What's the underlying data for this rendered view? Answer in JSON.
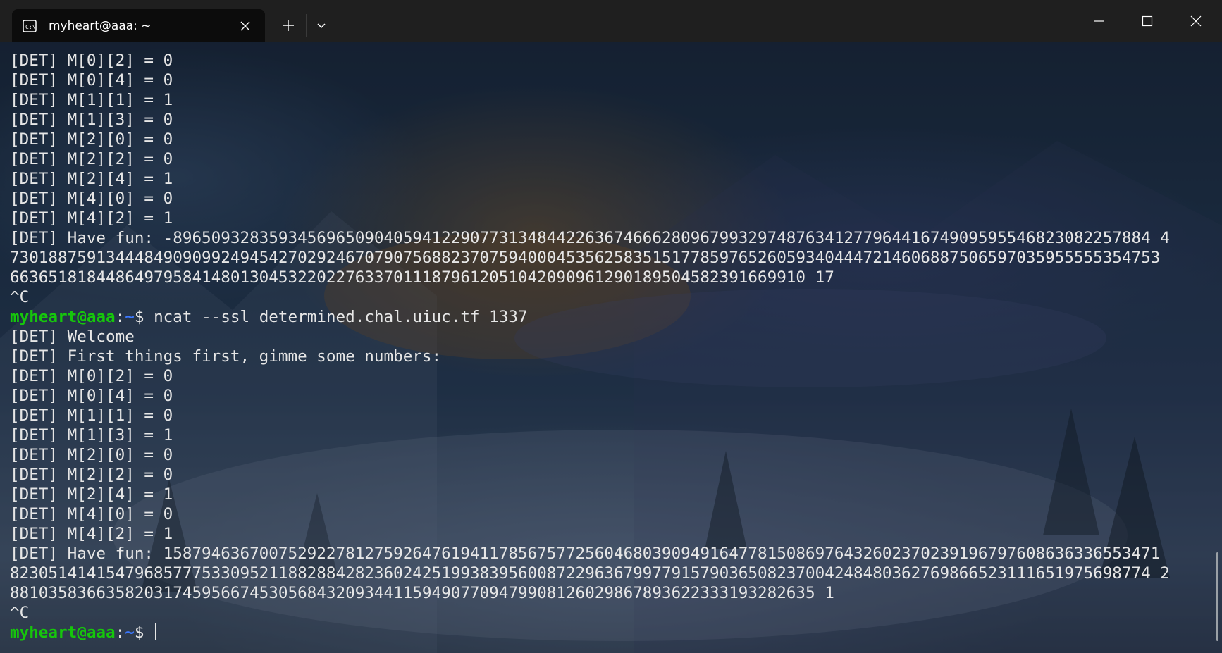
{
  "tab": {
    "title": "myheart@aaa: ~",
    "icon": "terminal-icon"
  },
  "controls": {
    "new_tab_icon": "plus-icon",
    "dropdown_icon": "chevron-down-icon",
    "minimize_icon": "minimize-icon",
    "maximize_icon": "maximize-icon",
    "close_icon": "close-icon"
  },
  "colors": {
    "prompt_user": "#16c60c",
    "prompt_path": "#3b78ff",
    "text": "#e6e6e6",
    "titlebar": "#1f1f1f",
    "tab_active": "#0c0c0c"
  },
  "prompt": {
    "user": "myheart@aaa",
    "sep": ":",
    "path": "~",
    "sign": "$ "
  },
  "terminal": {
    "lines": [
      "[DET] M[0][2] = 0",
      "[DET] M[0][4] = 0",
      "[DET] M[1][1] = 1",
      "[DET] M[1][3] = 0",
      "[DET] M[2][0] = 0",
      "[DET] M[2][2] = 0",
      "[DET] M[2][4] = 1",
      "[DET] M[4][0] = 0",
      "[DET] M[4][2] = 1",
      "[DET] Have fun: -896509328359345696509040594122907731348442263674666280967993297487634127796441674909595546823082257884 4",
      "730188759134448490909924945427029246707907568823707594000453562583515177859765260593404447214606887506597035955555354753",
      "66365181844864979584148013045322022763370111879612051042090961290189504582391669910 17",
      "^C",
      "ncat --ssl determined.chal.uiuc.tf 1337",
      "[DET] Welcome",
      "[DET] First things first, gimme some numbers:",
      "[DET] M[0][2] = 0",
      "[DET] M[0][4] = 0",
      "[DET] M[1][1] = 0",
      "[DET] M[1][3] = 1",
      "[DET] M[2][0] = 0",
      "[DET] M[2][2] = 0",
      "[DET] M[2][4] = 1",
      "[DET] M[4][0] = 0",
      "[DET] M[4][2] = 1",
      "[DET] Have fun: 15879463670075292278127592647619411785675772560468039094916477815086976432602370239196797608636336553471",
      "82305141415479685777533095211882884282360242519938395600872296367997791579036508237004248480362769866523111651975698774 2",
      "881035836635820317459566745305684320934411594907709479908126029867893622333193282635 1",
      "^C",
      ""
    ]
  }
}
